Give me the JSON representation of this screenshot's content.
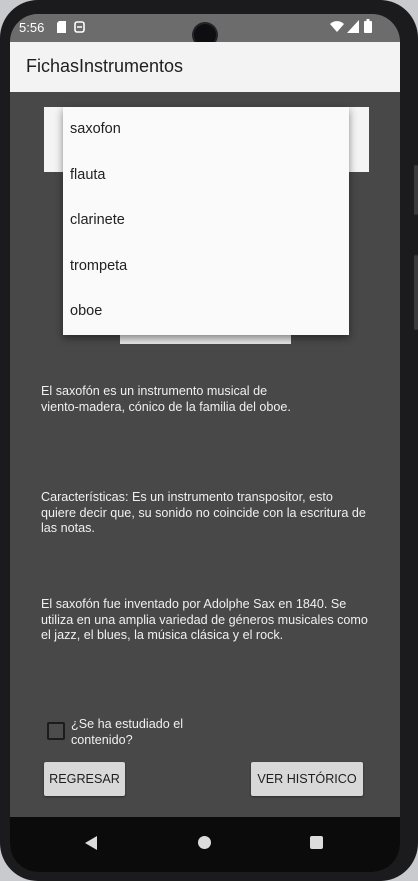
{
  "status_bar": {
    "time": "5:56",
    "icons": [
      "sd-card-icon",
      "sync-icon",
      "wifi-icon",
      "signal-icon",
      "battery-icon"
    ]
  },
  "app_bar": {
    "title": "FichasInstrumentos"
  },
  "spinner": {
    "options": [
      "saxofon",
      "flauta",
      "clarinete",
      "trompeta",
      "oboe"
    ]
  },
  "content": {
    "description": "El saxofón es un instrumento musical de viento-madera, cónico de la familia del oboe.",
    "characteristics": "Características: Es un instrumento transpositor, esto quiere decir que, su sonido no coincide con la escritura de las notas.",
    "history": "El saxofón fue inventado por Adolphe Sax en 1840. Se utiliza en una amplia variedad de géneros musicales como el jazz, el blues, la música clásica y el rock."
  },
  "checkbox": {
    "label": "¿Se ha estudiado el contenido?",
    "checked": false
  },
  "buttons": {
    "back": "REGRESAR",
    "history": "VER HISTÓRICO"
  },
  "nav_bar": {
    "icons": [
      "back-icon",
      "home-icon",
      "recents-icon"
    ]
  },
  "colors": {
    "background": "#484848",
    "app_bar": "#f3f3f3",
    "status_bar": "#6c6c6c",
    "button": "#d8d8d8",
    "nav_bar": "#0b0b0b"
  }
}
